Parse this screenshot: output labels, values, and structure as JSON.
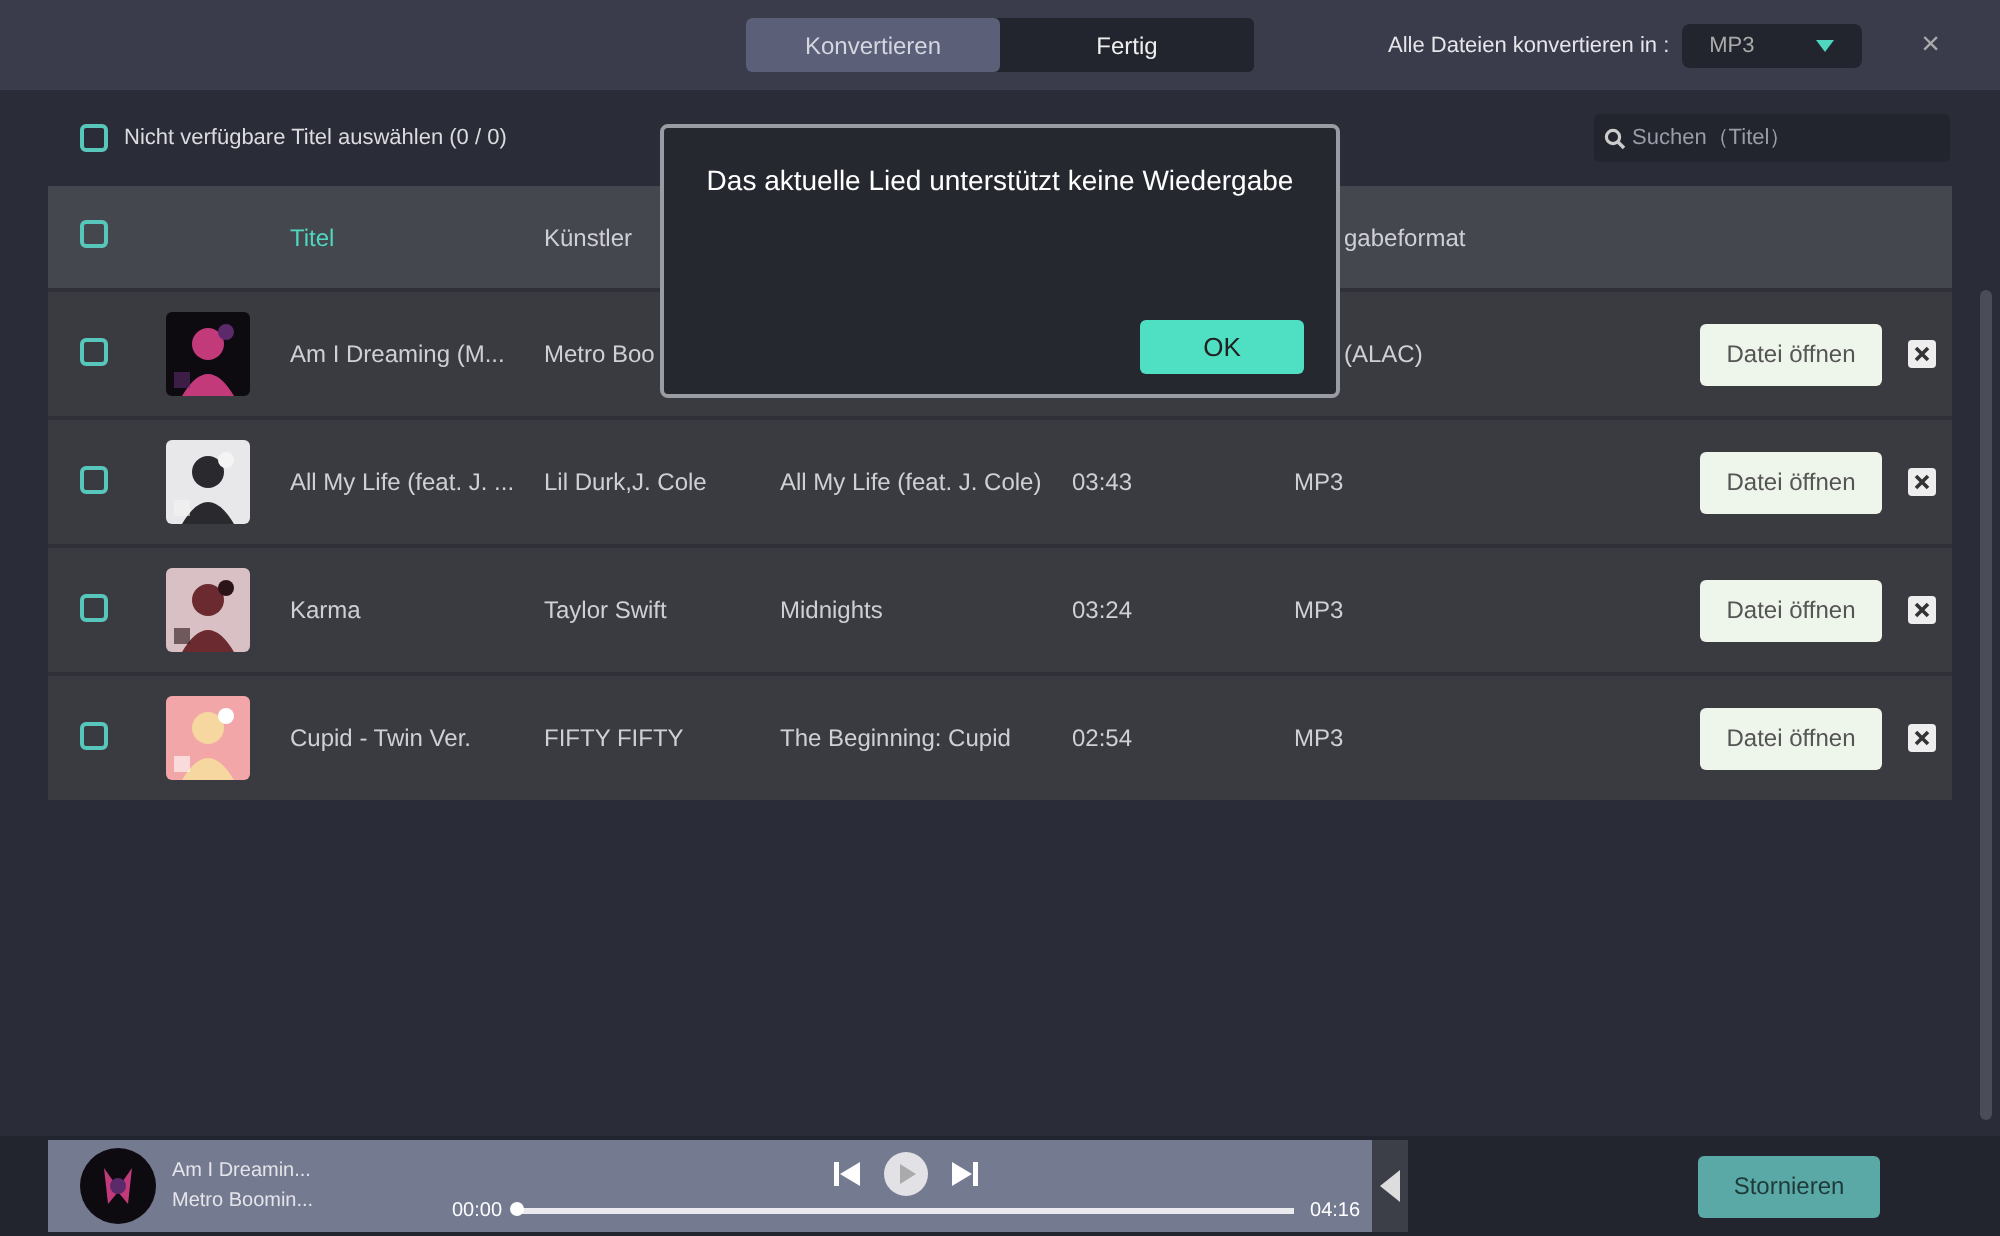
{
  "window": {
    "tabs": [
      {
        "label": "Konvertieren",
        "selected": true
      },
      {
        "label": "Fertig",
        "selected": false
      }
    ],
    "format_label": "Alle Dateien konvertieren in :",
    "format_value": "MP3",
    "close": "×"
  },
  "toolbar": {
    "select_unavailable": {
      "label": "Nicht verfügbare Titel auswählen (0 / 0)",
      "checked": false
    },
    "search": {
      "placeholder": "Suchen（Titel）"
    }
  },
  "table": {
    "select_all_checked": false,
    "columns": [
      "Titel",
      "Künstler",
      "gabeformat"
    ],
    "rows": [
      {
        "checked": false,
        "title": "Am I Dreaming (M...",
        "artist": "Metro Boo",
        "format": "(ALAC)",
        "action": "Datei öffnen"
      },
      {
        "checked": false,
        "title": "All My Life (feat. J. ...",
        "artist": "Lil Durk,J. Cole",
        "album": "All My Life (feat. J. Cole)",
        "duration": "03:43",
        "format": "MP3",
        "action": "Datei öffnen"
      },
      {
        "checked": false,
        "title": "Karma",
        "artist": "Taylor Swift",
        "album": "Midnights",
        "duration": "03:24",
        "format": "MP3",
        "action": "Datei öffnen"
      },
      {
        "checked": false,
        "title": "Cupid - Twin Ver.",
        "artist": "FIFTY FIFTY",
        "album": "The Beginning: Cupid",
        "duration": "02:54",
        "format": "MP3",
        "action": "Datei öffnen"
      }
    ]
  },
  "player": {
    "title": "Am I Dreamin...",
    "artist": "Metro Boomin...",
    "elapsed": "00:00",
    "total": "04:16",
    "level": 0
  },
  "cancel_button": "Stornieren",
  "dialog": {
    "message": "Das aktuelle Lied unterstützt keine Wiedergabe",
    "ok": "OK"
  }
}
